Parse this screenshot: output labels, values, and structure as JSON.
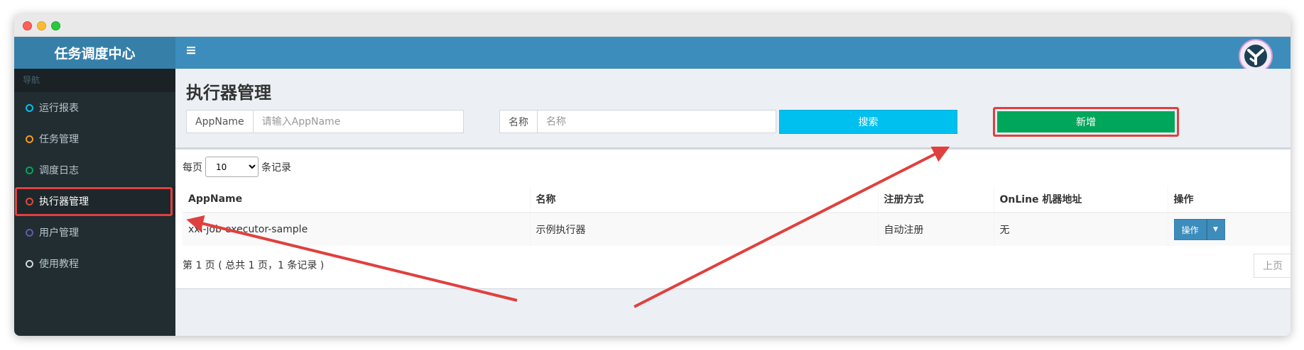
{
  "app": {
    "title": "任务调度中心"
  },
  "sidebar": {
    "header": "导航",
    "items": [
      {
        "label": "运行报表",
        "dot_color": "#00c0ef"
      },
      {
        "label": "任务管理",
        "dot_color": "#f39c12"
      },
      {
        "label": "调度日志",
        "dot_color": "#00a65a"
      },
      {
        "label": "执行器管理",
        "dot_color": "#dd4b39",
        "active": true
      },
      {
        "label": "用户管理",
        "dot_color": "#605ca8"
      },
      {
        "label": "使用教程",
        "dot_color": "#d2d6de"
      }
    ]
  },
  "topbar": {
    "menu_icon": "≡",
    "avatar_icon": "logo-icon"
  },
  "page": {
    "title": "执行器管理"
  },
  "filters": {
    "appname_label": "AppName",
    "appname_placeholder": "请输入AppName",
    "name_label": "名称",
    "name_placeholder": "名称",
    "search_label": "搜索",
    "add_label": "新增"
  },
  "table": {
    "length_prefix": "每页",
    "length_value": "10",
    "length_suffix": "条记录",
    "columns": [
      "AppName",
      "名称",
      "注册方式",
      "OnLine 机器地址",
      "操作"
    ],
    "rows": [
      {
        "appname": "xxl-job-executor-sample",
        "name": "示例执行器",
        "registry": "自动注册",
        "online": "无",
        "action": "操作"
      }
    ],
    "info": "第 1 页 ( 总共 1 页，1 条记录 )",
    "prev_label": "上页"
  },
  "colors": {
    "brand": "#3c8dbc",
    "sidebar": "#222d32",
    "success": "#00a65a",
    "info": "#00c0ef",
    "annotation": "#e0403d"
  }
}
